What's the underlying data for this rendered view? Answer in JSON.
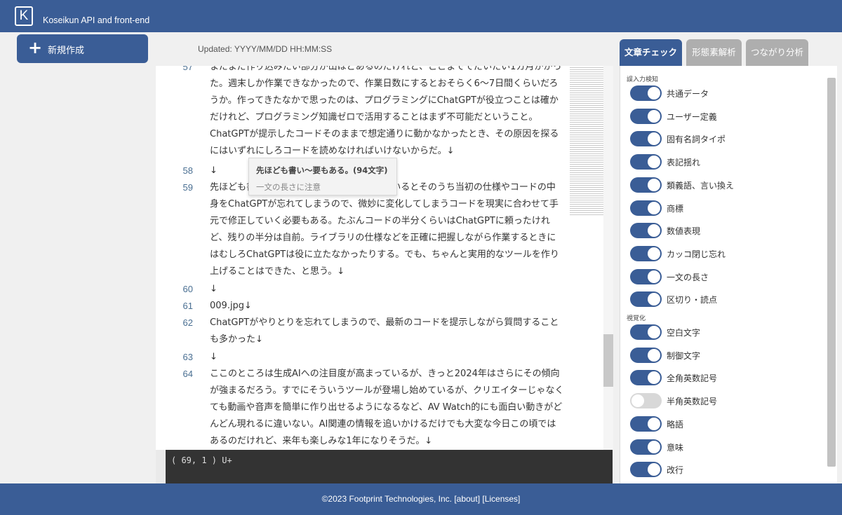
{
  "header": {
    "logo": "K",
    "title": "Koseikun API and front-end"
  },
  "new_button": {
    "plus": "+",
    "label": "新規作成"
  },
  "updated": "Updated: YYYY/MM/DD HH:MM:SS",
  "tabs": [
    {
      "label": "文章チェック"
    },
    {
      "label": "形態素解析"
    },
    {
      "label": "つながり分析"
    }
  ],
  "editor": {
    "lines": [
      {
        "no": "57",
        "text": "まだまだ作り込みたい部分が山ほどあるのだけれど、ここまででだいたい1カ月かかった。週末しか作業できなかったので、作業日数にするとおそらく6～7日間くらいだろうか。作ってきたなかで思ったのは、プログラミングにChatGPTが役立つことは確かだけれど、プログラミング知識ゼロで活用することはまず不可能だということ。ChatGPTが提示したコードそのままで想定通りに動かなかったとき、その原因を探るにはいずれにしろコードを読めなければいけないからだ。↓"
      },
      {
        "no": "58",
        "text": "↓"
      },
      {
        "no": "59",
        "text": "先ほども書いたように、何度もやりとりしているとそのうち当初の仕様やコードの中身をChatGPTが忘れてしまうので、微妙に変化してしまうコードを現実に合わせて手元で修正していく必要もある。たぶんコードの半分くらいはChatGPTに頼ったけれど、残りの半分は自前。ライブラリの仕様などを正確に把握しながら作業するときにはむしろChatGPTは役に立たなかったりする。でも、ちゃんと実用的なツールを作り上げることはできた、と思う。↓"
      },
      {
        "no": "60",
        "text": "↓"
      },
      {
        "no": "61",
        "text": "009.jpg↓"
      },
      {
        "no": "62",
        "text": "ChatGPTがやりとりを忘れてしまうので、最新のコードを提示しながら質問することも多かった↓"
      },
      {
        "no": "63",
        "text": "↓"
      },
      {
        "no": "64",
        "text": "ここのところは生成AIへの注目度が高まっているが、きっと2024年はさらにその傾向が強まるだろう。すでにそういうツールが登場し始めているが、クリエイターじゃなくても動画や音声を簡単に作り出せるようになるなど、AV Watch的にも面白い動きがどんどん現れるに違いない。AI関連の情報を追いかけるだけでも大変な今日この頃ではあるのだけれど、来年も楽しみな1年になりそうだ。↓"
      }
    ],
    "tooltip": {
      "title": "先ほども書い～要もある。(94文字)",
      "message": "一文の長さに注意"
    },
    "status": "( 69, 1 ) U+"
  },
  "panel": {
    "section_input": "誤入力検知",
    "section_visual": "視覚化",
    "toggles_input": [
      {
        "label": "共通データ",
        "on": true
      },
      {
        "label": "ユーザー定義",
        "on": true
      },
      {
        "label": "固有名詞タイポ",
        "on": true
      },
      {
        "label": "表記揺れ",
        "on": true
      },
      {
        "label": "類義語、言い換え",
        "on": true
      },
      {
        "label": "商標",
        "on": true
      },
      {
        "label": "数値表現",
        "on": true
      },
      {
        "label": "カッコ閉じ忘れ",
        "on": true
      },
      {
        "label": "一文の長さ",
        "on": true
      },
      {
        "label": "区切り・読点",
        "on": true
      }
    ],
    "toggles_visual": [
      {
        "label": "空白文字",
        "on": true
      },
      {
        "label": "制御文字",
        "on": true
      },
      {
        "label": "全角英数記号",
        "on": true
      },
      {
        "label": "半角英数記号",
        "on": false
      },
      {
        "label": "略語",
        "on": true
      },
      {
        "label": "意味",
        "on": true
      },
      {
        "label": "改行",
        "on": true
      }
    ]
  },
  "footer": "©2023 Footprint Technologies, Inc. [about] [Licenses]"
}
